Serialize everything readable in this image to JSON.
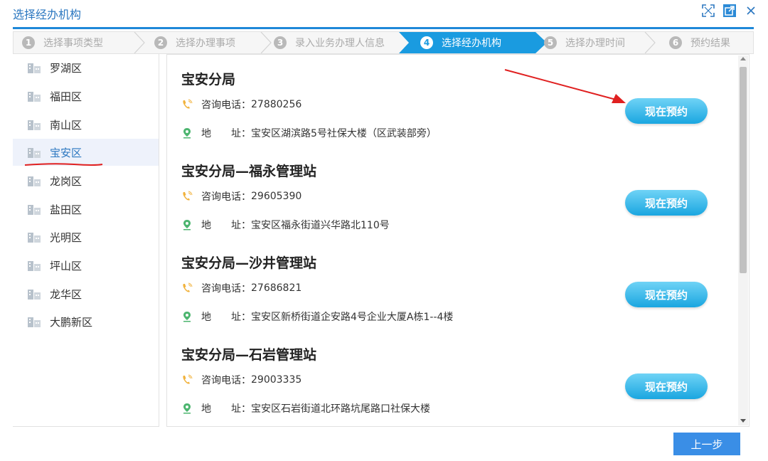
{
  "window": {
    "title": "选择经办机构"
  },
  "steps": [
    {
      "num": "1",
      "label": "选择事项类型",
      "active": false
    },
    {
      "num": "2",
      "label": "选择办理事项",
      "active": false
    },
    {
      "num": "3",
      "label": "录入业务办理人信息",
      "active": false
    },
    {
      "num": "4",
      "label": "选择经办机构",
      "active": true
    },
    {
      "num": "5",
      "label": "选择办理时间",
      "active": false
    },
    {
      "num": "6",
      "label": "预约结果",
      "active": false
    }
  ],
  "districts": [
    {
      "label": "罗湖区"
    },
    {
      "label": "福田区"
    },
    {
      "label": "南山区"
    },
    {
      "label": "宝安区",
      "selected": true
    },
    {
      "label": "龙岗区"
    },
    {
      "label": "盐田区"
    },
    {
      "label": "光明区"
    },
    {
      "label": "坪山区"
    },
    {
      "label": "龙华区"
    },
    {
      "label": "大鹏新区"
    }
  ],
  "offices": [
    {
      "name": "宝安分局",
      "phone_label": "咨询电话：",
      "phone": "27880256",
      "addr_label": "地　　址：",
      "address": "宝安区湖滨路5号社保大楼（区武装部旁）",
      "button": "现在预约"
    },
    {
      "name": "宝安分局—福永管理站",
      "phone_label": "咨询电话：",
      "phone": "29605390",
      "addr_label": "地　　址：",
      "address": "宝安区福永街道兴华路北110号",
      "button": "现在预约"
    },
    {
      "name": "宝安分局—沙井管理站",
      "phone_label": "咨询电话：",
      "phone": "27686821",
      "addr_label": "地　　址：",
      "address": "宝安区新桥街道企安路4号企业大厦A栋1--4楼",
      "button": "现在预约"
    },
    {
      "name": "宝安分局—石岩管理站",
      "phone_label": "咨询电话：",
      "phone": "29003335",
      "addr_label": "地　　址：",
      "address": "宝安区石岩街道北环路坑尾路口社保大楼",
      "button": "现在预约"
    }
  ],
  "footer": {
    "prev_label": "上一步"
  },
  "colors": {
    "accent": "#1e88d8",
    "step_active": "#1a9be0",
    "button_gradient_top": "#6fd3f6",
    "button_gradient_bottom": "#1aa6e0",
    "annotation_red": "#e02020"
  },
  "icons": {
    "window": [
      "fullscreen-icon",
      "popout-icon",
      "close-icon"
    ],
    "district": "building-icon",
    "phone": "phone-icon",
    "address": "location-pin-icon"
  }
}
